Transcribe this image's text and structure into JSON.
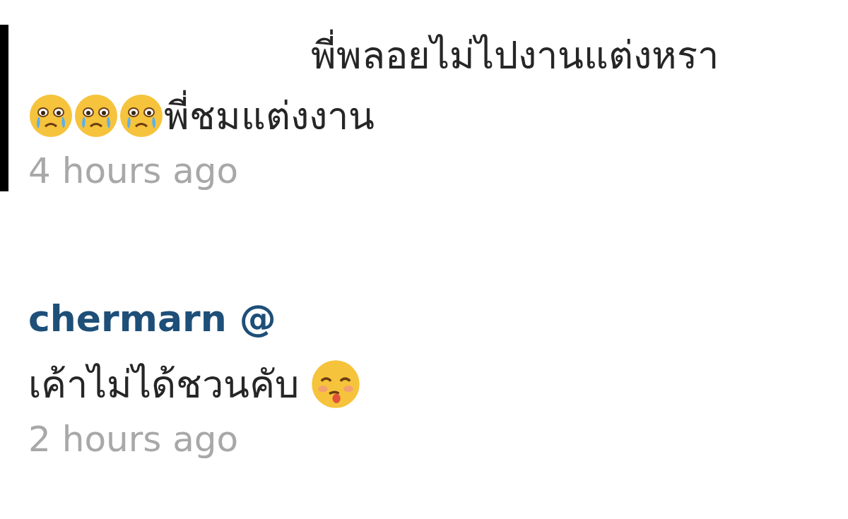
{
  "comments": [
    {
      "bordered": true,
      "lines": [
        [
          {
            "kind": "text",
            "text": "พี่พลอยไม่ไปงานแต่งหรา"
          }
        ],
        [
          {
            "kind": "crying_emoji"
          },
          {
            "kind": "crying_emoji"
          },
          {
            "kind": "crying_emoji"
          },
          {
            "kind": "text",
            "text": "พี่ชมแต่งงาน"
          }
        ]
      ],
      "time": "4 hours ago"
    },
    {
      "username": "chermarn @",
      "bordered": false,
      "lines": [
        [
          {
            "kind": "text",
            "text": "เค้าไม่ได้ชวนคับ"
          },
          {
            "kind": "tongue_emoji"
          }
        ]
      ],
      "time": "2 hours ago"
    }
  ]
}
